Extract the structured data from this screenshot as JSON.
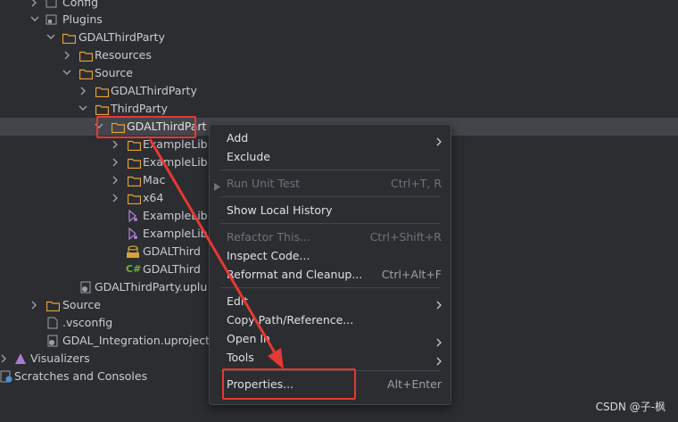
{
  "tree": {
    "config": "Config",
    "plugins": "Plugins",
    "gdal_third_party": "GDALThirdParty",
    "resources": "Resources",
    "source": "Source",
    "gdal_third_party_inner": "GDALThirdParty",
    "third_party": "ThirdParty",
    "gdal_third_party_lib": "GDALThirdPart",
    "example_lib_1": "ExampleLib",
    "example_lib_2": "ExampleLib",
    "mac": "Mac",
    "x64": "x64",
    "example_lib_3": "ExampleLib",
    "example_lib_4": "ExampleLib",
    "gdal_third_sql": "GDALThird",
    "gdal_third_cs": "GDALThird",
    "uplugin": "GDALThirdParty.uplu",
    "source_root": "Source",
    "vsconfig": ".vsconfig",
    "uproject": "GDAL_Integration.uproject",
    "visualizers": "Visualizers",
    "scratches": "Scratches and Consoles"
  },
  "context_menu": {
    "add": "Add",
    "exclude": "Exclude",
    "run_unit_test": "Run Unit Test",
    "run_unit_test_shortcut": "Ctrl+T, R",
    "show_local_history": "Show Local History",
    "refactor_this": "Refactor This...",
    "refactor_this_shortcut": "Ctrl+Shift+R",
    "inspect_code": "Inspect Code...",
    "reformat": "Reformat and Cleanup...",
    "reformat_shortcut": "Ctrl+Alt+F",
    "edit": "Edit",
    "copy_path": "Copy Path/Reference...",
    "open_in": "Open In",
    "tools": "Tools",
    "properties": "Properties...",
    "properties_shortcut": "Alt+Enter"
  },
  "watermark": "CSDN @子-枫",
  "colors": {
    "background": "#2b2d30",
    "selection": "#43454a",
    "folder": "#e8a33d",
    "highlight": "#e53935"
  }
}
